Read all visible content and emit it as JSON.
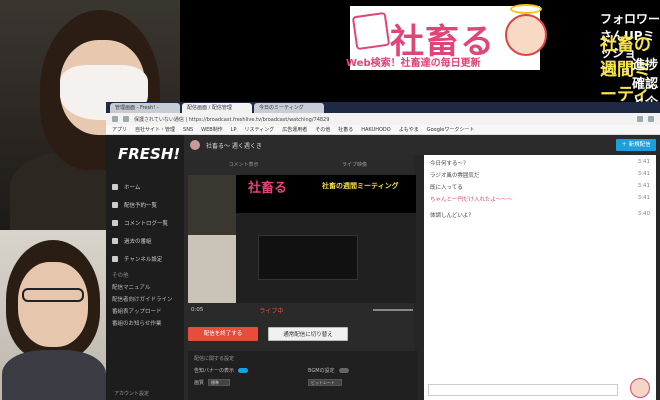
{
  "banner": {
    "brand": "社畜る",
    "brand_sub": "Web検索！社畜達の毎日更新",
    "mission": "フォロワーさんUPミッション！！",
    "meeting": "社畜の週間ミーティング",
    "meeting_sub": "進捗確認と企画会議"
  },
  "browser": {
    "tabs": [
      "管理画面 - Fresh! -",
      "配信画面 / 配信管理",
      "今日のミーティング"
    ],
    "address": "保護されていない通信 | https://broadcast.freshlive.tv/broadcast/watching/74829",
    "bookmarks": [
      "アプリ",
      "自社サイト・管理",
      "SNS",
      "WEB制作",
      "LP",
      "リスティング",
      "広告運用者",
      "その他",
      "社畜る",
      "HAKUHODO",
      "よもやま",
      "Googleワークシート"
    ]
  },
  "sidebar": {
    "logo": "FRESH!",
    "items": [
      "ホーム",
      "配信予約一覧",
      "コメントログ一覧",
      "過去の番組",
      "チャンネル設定"
    ],
    "section": "その他",
    "sub_items": [
      "配信マニュアル",
      "配信者向けガイドライン",
      "番組表アップロード",
      "番組のお知らせ作業"
    ],
    "account": "アカウント設定"
  },
  "topbar": {
    "channel": "社畜る〜 週く週くき",
    "new_button": "＋ 新規配信"
  },
  "stage": {
    "tab_left": "コメント表示",
    "tab_right": "ライブ映像",
    "time": "0:05",
    "live_label": "ライブ中",
    "end_button": "配信を終了する",
    "switch_button": "通常配信に切り替え",
    "settings_title": "配信に関する設定",
    "setting_a": "告知バナーの表示",
    "setting_b": "BGMの設定",
    "setting_c": "画質",
    "setting_c_value": "標準",
    "setting_d": "ビットレート"
  },
  "chat": {
    "messages": [
      {
        "text": "今日何する〜？",
        "time": "3:41"
      },
      {
        "text": "ラジオ風の雰囲気だ",
        "time": "3:41"
      },
      {
        "text": "既に入ってる",
        "time": "3:41"
      },
      {
        "text": "ちゃんと一円だけ入れたよ〜〜〜",
        "time": "3:41"
      },
      {
        "text": "体調しんどいよ？",
        "time": "3:40"
      }
    ]
  }
}
